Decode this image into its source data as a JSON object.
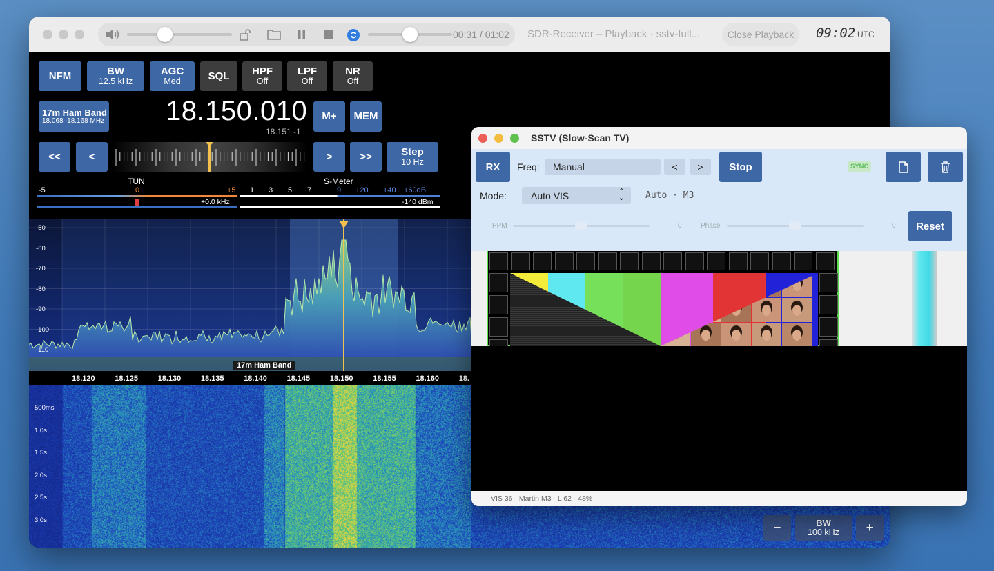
{
  "titlebar": {
    "time_counter": "00:31 / 01:02",
    "title": "SDR-Receiver – Playback · sstv-full...",
    "close_playback": "Close Playback",
    "clock": "09:02",
    "clock_zone": "UTC",
    "volume_level": 0.4,
    "playback_position": 0.5
  },
  "controls": {
    "mode": "NFM",
    "bw_label": "BW",
    "bw_value": "12.5 kHz",
    "agc_label": "AGC",
    "agc_value": "Med",
    "sql_label": "SQL",
    "hpf_label": "HPF",
    "hpf_value": "Off",
    "lpf_label": "LPF",
    "lpf_value": "Off",
    "nr_label": "NR",
    "nr_value": "Off",
    "band_name": "17m Ham Band",
    "band_range": "18.068–18.168 MHz",
    "frequency": "18.150.010",
    "sub_frequency": "18.151 -1",
    "mem_plus": "M+",
    "mem": "MEM",
    "step_back_fast": "<<",
    "step_back": "<",
    "step_fwd": ">",
    "step_fwd_fast": ">>",
    "step_label": "Step",
    "step_value": "10 Hz"
  },
  "tuning": {
    "label": "TUN",
    "min": "-5",
    "center": "0",
    "max": "+5",
    "offset": "+0.0 kHz"
  },
  "smeter": {
    "label": "S-Meter",
    "scale": [
      "1",
      "3",
      "5",
      "7",
      "9",
      "+20",
      "+40",
      "+60dB"
    ],
    "reading": "-140 dBm"
  },
  "spectrum": {
    "y_labels": [
      "-50",
      "-60",
      "-70",
      "-80",
      "-90",
      "-100",
      "-110"
    ],
    "x_labels": [
      "18.120",
      "18.125",
      "18.130",
      "18.135",
      "18.140",
      "18.145",
      "18.150",
      "18.155",
      "18.160",
      "18."
    ],
    "band_label": "17m Ham Band",
    "colors": {
      "trace_top": "#8fd18a",
      "trace_bottom": "#2a3fb0",
      "marker": "#f2c24d"
    }
  },
  "waterfall": {
    "time_labels": [
      "500ms",
      "1.0s",
      "1.5s",
      "2.0s",
      "2.5s",
      "3.0s"
    ],
    "zoom_out": "−",
    "bw_label": "BW",
    "bw_value": "100 kHz",
    "zoom_in": "+"
  },
  "sstv": {
    "title": "SSTV (Slow-Scan TV)",
    "rx": "RX",
    "freq_label": "Freq:",
    "freq_value": "Manual",
    "prev": "<",
    "next": ">",
    "stop": "Stop",
    "sync": "SYNC",
    "mode_label": "Mode:",
    "mode_value": "Auto VIS",
    "mode_info": "Auto · M3",
    "ppm_label": "PPM",
    "ppm_value": "0",
    "phase_label": "Phase",
    "phase_value": "0",
    "reset": "Reset",
    "status": "VIS 36 · Martin M3 · L 62 · 48%"
  }
}
